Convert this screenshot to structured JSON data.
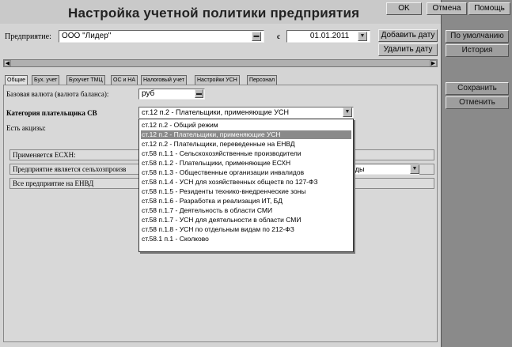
{
  "window": {
    "title": "Настройка учетной политики предприятия",
    "ok_label": "OK",
    "cancel_label": "Отмена",
    "help_label": "Помощь"
  },
  "header": {
    "enterprise_label": "Предприятие:",
    "enterprise_value": "ООО \"Лидер\"",
    "date_from_label": "с",
    "date_value": "01.01.2011",
    "add_date_label": "Добавить дату",
    "remove_date_label": "Удалить дату"
  },
  "side": {
    "default_label": "По умолчанию",
    "history_label": "История",
    "save_label": "Сохранить",
    "cancel_label": "Отменить"
  },
  "tabs": [
    "Общие",
    "Бух. учет",
    "Бухучет ТМЦ",
    "ОС и НА",
    "Налоговый учет",
    "Настройки УСН",
    "Персонал"
  ],
  "form": {
    "base_currency_label": "Базовая валюта (валюта баланса):",
    "base_currency_value": "руб",
    "category_label": "Категория плательщика СВ",
    "category_value": "ст.12 п.2 - Плательщики, применяющие УСН",
    "excise_label": "Есть акцизы:",
    "eskhn_label": "Применяется ЕСХН:",
    "agri_label": "Предприятие является сельхозпроизв",
    "agri_value_tail": "оды",
    "envd_label": "Все предприятие на ЕНВД"
  },
  "dropdown": {
    "selected_index": 1,
    "options": [
      "ст.12 п.2 - Общий режим",
      "ст.12 п.2 - Плательщики, применяющие УСН",
      "ст.12 п.2 - Плательщики, переведенные на ЕНВД",
      "ст.58 п.1.1 - Сельскохозяйственные производители",
      "ст.58 п.1.2 - Плательщики, применяющие ЕСХН",
      "ст.58 п.1.3 - Общественные организации инвалидов",
      "ст.58 п.1.4 - УСН для хозяйственных обществ по 127-ФЗ",
      "ст.58 п.1.5 - Резиденты технико-внедренческие зоны",
      "ст.58 п.1.6 - Разработка и реализация ИТ, БД",
      "ст.58 п.1.7 - Деятельность в области СМИ",
      "ст.58 п.1.7 - УСН для деятельности в области СМИ",
      "ст.58 п.1.8 - УСН по отдельным видам по 212-ФЗ",
      "ст.58.1 п.1 - Сколково"
    ]
  },
  "icons": {
    "dropdown_arrow": "triangle-down-glyph",
    "picker": "ellipsis-glyph",
    "scroll_left": "triangle-left-glyph",
    "scroll_right": "triangle-right-glyph"
  }
}
